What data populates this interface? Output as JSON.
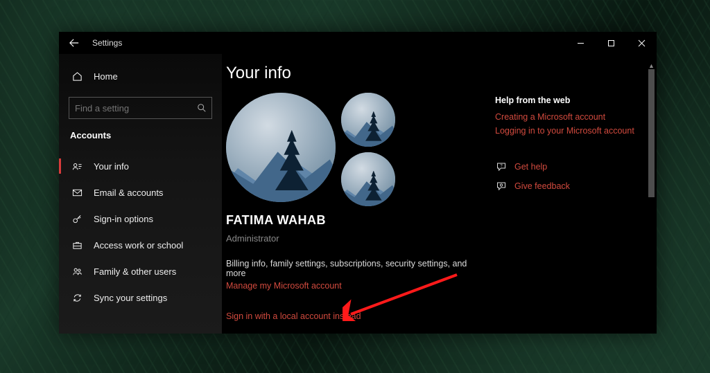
{
  "window": {
    "title": "Settings"
  },
  "nav": {
    "home": "Home",
    "search_placeholder": "Find a setting",
    "section": "Accounts",
    "items": [
      {
        "label": "Your info"
      },
      {
        "label": "Email & accounts"
      },
      {
        "label": "Sign-in options"
      },
      {
        "label": "Access work or school"
      },
      {
        "label": "Family & other users"
      },
      {
        "label": "Sync your settings"
      }
    ]
  },
  "page": {
    "title": "Your info",
    "username": "FATIMA WAHAB",
    "role": "Administrator",
    "billing_desc": "Billing info, family settings, subscriptions, security settings, and more",
    "manage_link": "Manage my Microsoft account",
    "local_link": "Sign in with a local account instead"
  },
  "help": {
    "header": "Help from the web",
    "links": [
      "Creating a Microsoft account",
      "Logging in to your Microsoft account"
    ],
    "actions": [
      "Get help",
      "Give feedback"
    ]
  }
}
